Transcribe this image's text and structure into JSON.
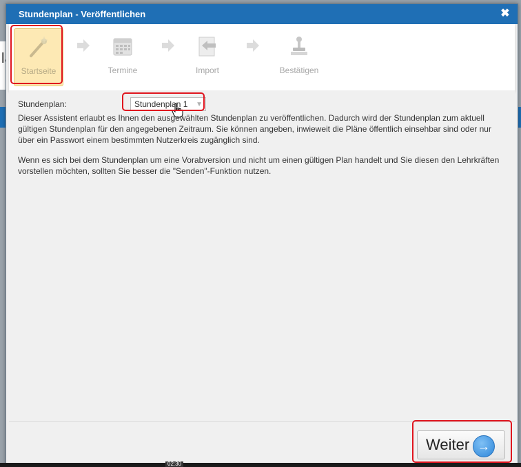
{
  "background": {
    "partial_letter": "lä"
  },
  "dialog": {
    "title": "Stundenplan - Veröffentlichen",
    "close_icon": "close-icon"
  },
  "wizard": {
    "steps": [
      {
        "label": "Startseite",
        "icon": "magic-wand-icon",
        "active": true
      },
      {
        "label": "Termine",
        "icon": "calendar-icon",
        "active": false
      },
      {
        "label": "Import",
        "icon": "import-icon",
        "active": false
      },
      {
        "label": "Bestätigen",
        "icon": "stamp-icon",
        "active": false
      }
    ]
  },
  "content": {
    "stundenplan_label": "Stundenplan:",
    "stundenplan_value": "Stundenplan 1",
    "paragraph1": "Dieser Assistent erlaubt es Ihnen den ausgewählten Stundenplan zu veröffentlichen. Dadurch wird der Stundenplan zum aktuell gültigen Stundenplan für den angegebenen Zeitraum. Sie können angeben, inwieweit die Pläne öffentlich einsehbar sind oder nur über ein Passwort einem bestimmten Nutzerkreis zugänglich sind.",
    "paragraph2": "Wenn es sich bei dem Stundenplan um eine Vorabversion und nicht um einen gültigen Plan handelt und Sie diesen den Lehrkräften vorstellen möchten, sollten Sie besser die \"Senden\"-Funktion nutzen."
  },
  "footer": {
    "next_label": "Weiter"
  },
  "video": {
    "timestamp": "02:30"
  },
  "colors": {
    "titlebar": "#1f6fb5",
    "highlight": "#e0141e",
    "active_step": "#fde9b4"
  }
}
